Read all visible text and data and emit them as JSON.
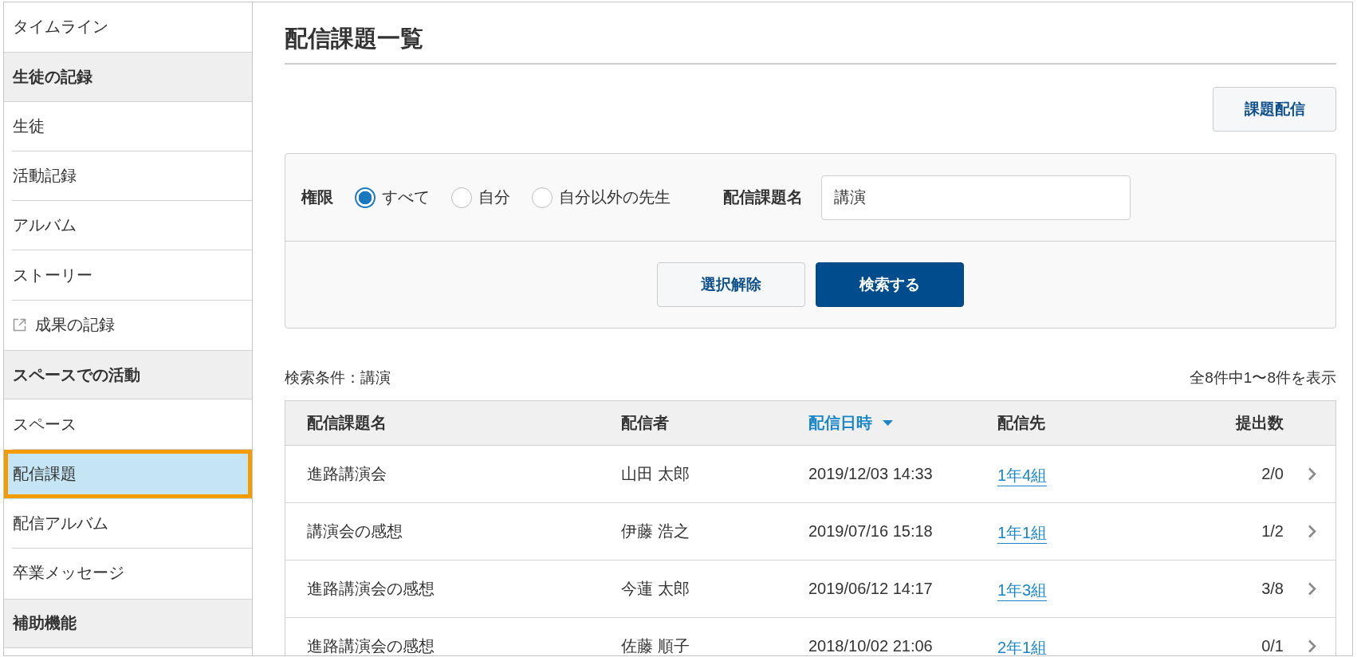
{
  "sidebar": {
    "items": [
      {
        "kind": "link",
        "label": "タイムライン",
        "selected": false
      },
      {
        "kind": "section",
        "label": "生徒の記録",
        "selected": false
      },
      {
        "kind": "link",
        "label": "生徒",
        "selected": false
      },
      {
        "kind": "link",
        "label": "活動記録",
        "selected": false
      },
      {
        "kind": "link",
        "label": "アルバム",
        "selected": false
      },
      {
        "kind": "link",
        "label": "ストーリー",
        "selected": false
      },
      {
        "kind": "external_link",
        "label": "成果の記録",
        "selected": false
      },
      {
        "kind": "section",
        "label": "スペースでの活動",
        "selected": false
      },
      {
        "kind": "link",
        "label": "スペース",
        "selected": false
      },
      {
        "kind": "link",
        "label": "配信課題",
        "selected": true
      },
      {
        "kind": "link",
        "label": "配信アルバム",
        "selected": false
      },
      {
        "kind": "link",
        "label": "卒業メッセージ",
        "selected": false
      },
      {
        "kind": "section",
        "label": "補助機能",
        "selected": false
      }
    ]
  },
  "page": {
    "title": "配信課題一覧",
    "action_button": {
      "label": "課題配信"
    }
  },
  "search_panel": {
    "permission": {
      "label": "権限",
      "options": [
        {
          "label": "すべて",
          "selected": true
        },
        {
          "label": "自分",
          "selected": false
        },
        {
          "label": "自分以外の先生",
          "selected": false
        }
      ]
    },
    "name_field": {
      "label": "配信課題名",
      "value": "講演"
    },
    "buttons": [
      {
        "kind": "secondary",
        "label": "選択解除"
      },
      {
        "kind": "primary",
        "label": "検索する"
      }
    ]
  },
  "results": {
    "condition": "検索条件：講演",
    "count": "全8件中1〜8件を表示"
  },
  "table": {
    "columns": [
      {
        "label": "配信課題名",
        "sorted": false
      },
      {
        "label": "配信者",
        "sorted": false
      },
      {
        "label": "配信日時",
        "sorted": true
      },
      {
        "label": "配信先",
        "sorted": false
      },
      {
        "label": "提出数",
        "sorted": false
      }
    ],
    "rows": [
      {
        "title": "進路講演会",
        "sender": "山田 太郎",
        "delivered_at": "2019/12/03 14:33",
        "target": "1年4組",
        "submissions": "2/0"
      },
      {
        "title": "講演会の感想",
        "sender": "伊藤 浩之",
        "delivered_at": "2019/07/16 15:18",
        "target": "1年1組",
        "submissions": "1/2"
      },
      {
        "title": "進路講演会の感想",
        "sender": "今蓮 太郎",
        "delivered_at": "2019/06/12 14:17",
        "target": "1年3組",
        "submissions": "3/8"
      },
      {
        "title": "進路講演会の感想",
        "sender": "佐藤 順子",
        "delivered_at": "2018/10/02 21:06",
        "target": "2年1組",
        "submissions": "0/1"
      }
    ]
  }
}
